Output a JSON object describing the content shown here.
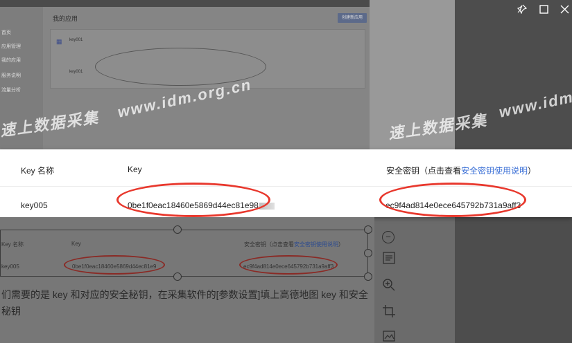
{
  "window_controls": {
    "pin_icon": "pin-icon",
    "maximize_icon": "maximize-icon",
    "close_icon": "close-icon"
  },
  "background": {
    "page_title": "我的应用",
    "new_app_button": "创建新应用",
    "sidebar_items": [
      "首页",
      "应用管理",
      "我的应用",
      "服务说明",
      "流量分析"
    ],
    "app_name": "key001",
    "row_key_name": "key001"
  },
  "watermark": {
    "text_left": "速上数据采集",
    "text_mid": "www.idm.org.cn",
    "text_right_cn": "速上数据采集",
    "text_right_url": "www.idm"
  },
  "popup": {
    "headers": {
      "key_name": "Key 名称",
      "key": "Key",
      "secret_prefix": "安全密钥（点击查看",
      "secret_link": "安全密钥使用说明",
      "secret_suffix": "）"
    },
    "row": {
      "key_name": "key005",
      "key_value": "0be1f0eac18460e5869d44ec81e98",
      "secret_value": "ec9f4ad814e0ece645792b731a9aff3"
    }
  },
  "lower_table": {
    "headers": {
      "key_name": "Key 名称",
      "key": "Key",
      "secret_prefix": "安全密钥（点击查看",
      "secret_link": "安全密钥使用说明",
      "secret_suffix": "）"
    },
    "row": {
      "key_name": "key005",
      "key_value": "0be1f0eac18460e5869d44ec81e9",
      "secret_value": "ec9f4ad814e0ece645792b731a9aff3"
    }
  },
  "caption": "们需要的是 key 和对应的安全秘钥，在采集软件的[参数设置]填上高德地图 key 和安全秘钥",
  "toolbar": {
    "minus_icon": "minus-icon",
    "text_icon": "text-icon",
    "zoom_icon": "zoom-in-icon",
    "crop_icon": "crop-icon",
    "image_icon": "image-icon"
  },
  "colors": {
    "link": "#3a6fd6",
    "oval": "#e8382d"
  }
}
